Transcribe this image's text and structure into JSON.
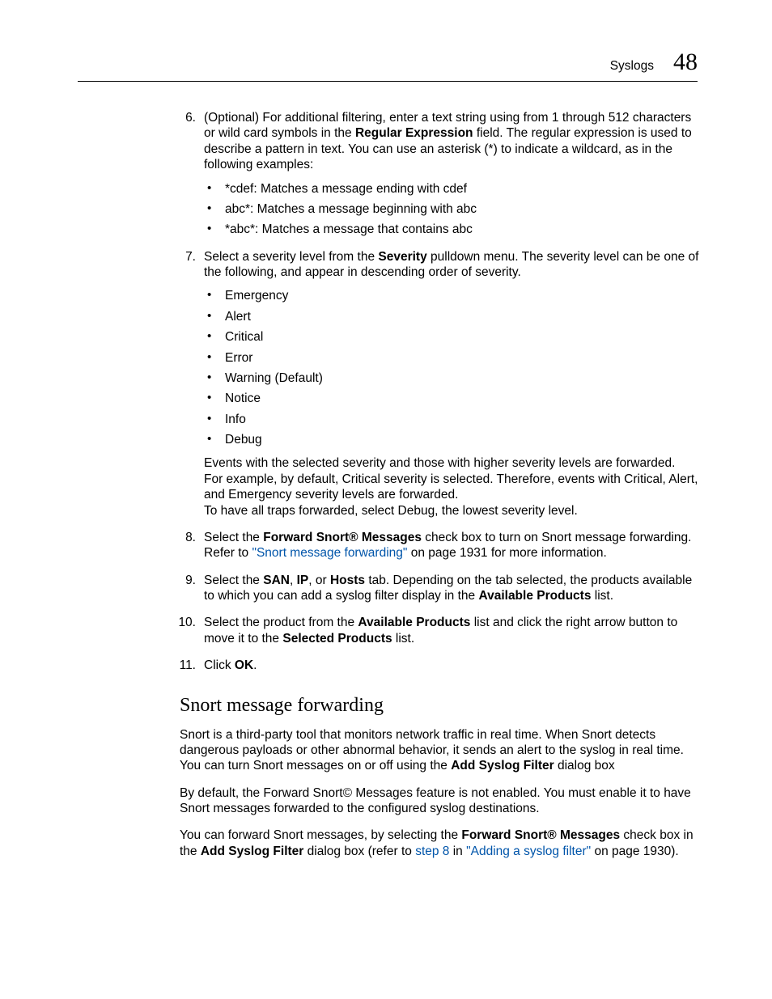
{
  "header": {
    "section": "Syslogs",
    "page_number": "48"
  },
  "steps": {
    "s6": {
      "num": "6.",
      "intro_a": "(Optional) For additional filtering, enter a text string using from 1 through 512 characters or wild card symbols in the ",
      "intro_bold": "Regular Expression",
      "intro_b": " field. The regular expression is used to describe a pattern in text. You can use an asterisk (*) to indicate a wildcard, as in the following examples:",
      "bullets": [
        "*cdef: Matches a message ending with cdef",
        "abc*: Matches a message beginning with abc",
        "*abc*: Matches a message that contains abc"
      ]
    },
    "s7": {
      "num": "7.",
      "intro_a": "Select a severity level from the ",
      "intro_bold": "Severity",
      "intro_b": " pulldown menu. The severity level can be one of the following, and appear in descending order of severity.",
      "bullets": [
        "Emergency",
        "Alert",
        "Critical",
        "Error",
        "Warning (Default)",
        "Notice",
        "Info",
        "Debug"
      ],
      "trail1": "Events with the selected severity and those with higher severity levels are forwarded.",
      "trail2": "For example, by default, Critical severity is selected. Therefore, events with Critical, Alert, and Emergency severity levels are forwarded.",
      "trail3": "To have all traps forwarded, select Debug, the lowest severity level."
    },
    "s8": {
      "num": "8.",
      "t1": "Select the ",
      "b1": "Forward Snort® Messages",
      "t2": " check box to turn on Snort message forwarding. Refer to ",
      "link": "\"Snort message forwarding\"",
      "t3": " on page 1931 for more information."
    },
    "s9": {
      "num": "9.",
      "t1": "Select the ",
      "b1": "SAN",
      "c1": ", ",
      "b2": "IP",
      "c2": ", or ",
      "b3": "Hosts",
      "t2": " tab. Depending on the tab selected, the products available to which you can add a syslog filter display in the ",
      "b4": "Available Products",
      "t3": " list."
    },
    "s10": {
      "num": "10.",
      "t1": "Select the product from the ",
      "b1": "Available Products",
      "t2": " list and click the right arrow button to move it to the ",
      "b2": "Selected Products",
      "t3": " list."
    },
    "s11": {
      "num": "11.",
      "t1": "Click ",
      "b1": "OK",
      "t2": "."
    }
  },
  "section": {
    "heading": "Snort message forwarding",
    "p1a": "Snort is a third-party tool that monitors network traffic in real time. When Snort detects dangerous payloads or other abnormal behavior, it sends an alert to the syslog in real time. You can turn Snort messages on or off using the ",
    "p1b": "Add Syslog Filter",
    "p1c": " dialog box",
    "p2": "By default, the Forward Snort© Messages feature is not enabled. You must enable it to have Snort messages forwarded to the configured syslog destinations.",
    "p3a": "You can forward Snort messages, by selecting the ",
    "p3b": "Forward Snort® Messages",
    "p3c": " check box in the ",
    "p3d": "Add Syslog Filter",
    "p3e": " dialog box (refer to ",
    "p3link1": "step 8",
    "p3f": " in ",
    "p3link2": "\"Adding a syslog filter\"",
    "p3g": " on page 1930)."
  }
}
